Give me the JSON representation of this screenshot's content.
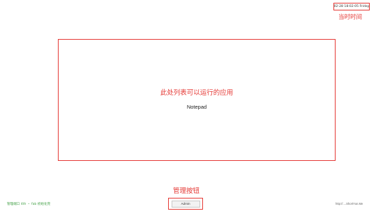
{
  "clock": {
    "value": "02-28 18:02:05 Friday",
    "annotation": "当时时间"
  },
  "app_list": {
    "annotation": "此处列表可以运行的应用",
    "items": [
      {
        "label": "Notepad"
      }
    ]
  },
  "admin": {
    "button_label": "Admin",
    "annotation": "管理按钮"
  },
  "status": {
    "left_text": "管理端口 4th ・ fab 初始化完",
    "right_text": "http://....ShortYun.Me"
  },
  "colors": {
    "annotation_red": "#e53935",
    "status_green": "#43a047"
  }
}
